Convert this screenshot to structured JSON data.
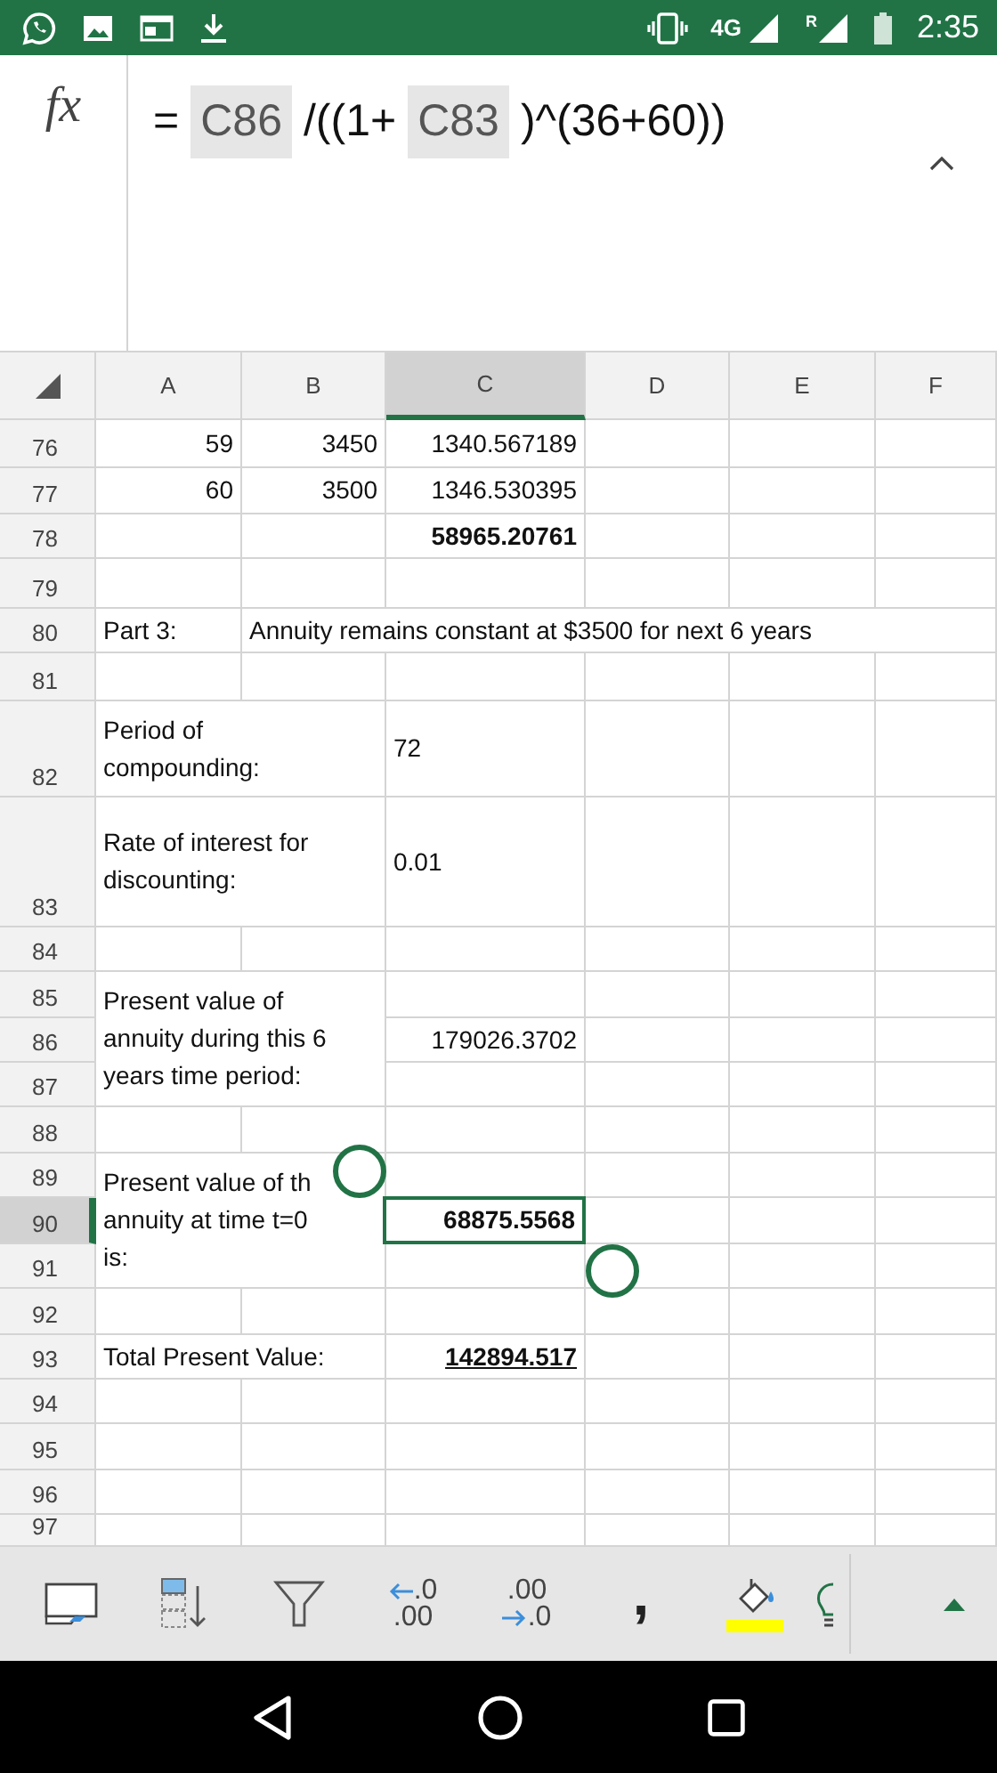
{
  "status_bar": {
    "network": "4G",
    "roaming": "R",
    "time": "2:35"
  },
  "formula_bar": {
    "function_label": "fx",
    "parts": [
      {
        "kind": "operator",
        "text": "="
      },
      {
        "kind": "reference",
        "text": "C86"
      },
      {
        "kind": "operator",
        "text": "/((1+"
      },
      {
        "kind": "reference",
        "text": "C83"
      },
      {
        "kind": "operator",
        "text": ")^(36+60))"
      }
    ]
  },
  "columns": [
    {
      "label": "A",
      "selected": false
    },
    {
      "label": "B",
      "selected": false
    },
    {
      "label": "C",
      "selected": true
    },
    {
      "label": "D",
      "selected": false
    },
    {
      "label": "E",
      "selected": false
    },
    {
      "label": "F",
      "selected": false
    }
  ],
  "rows": [
    {
      "number": "76",
      "selected": false
    },
    {
      "number": "77",
      "selected": false
    },
    {
      "number": "78",
      "selected": false
    },
    {
      "number": "79",
      "selected": false
    },
    {
      "number": "80",
      "selected": false
    },
    {
      "number": "81",
      "selected": false
    },
    {
      "number": "82",
      "selected": false
    },
    {
      "number": "83",
      "selected": false
    },
    {
      "number": "84",
      "selected": false
    },
    {
      "number": "85",
      "selected": false
    },
    {
      "number": "86",
      "selected": false
    },
    {
      "number": "87",
      "selected": false
    },
    {
      "number": "88",
      "selected": false
    },
    {
      "number": "89",
      "selected": false
    },
    {
      "number": "90",
      "selected": true
    },
    {
      "number": "91",
      "selected": false
    },
    {
      "number": "92",
      "selected": false
    },
    {
      "number": "93",
      "selected": false
    },
    {
      "number": "94",
      "selected": false
    },
    {
      "number": "95",
      "selected": false
    },
    {
      "number": "96",
      "selected": false
    },
    {
      "number": "97",
      "selected": false
    }
  ],
  "cells": [
    {
      "text": "59",
      "selected": false
    },
    {
      "text": "3450",
      "selected": false
    },
    {
      "text": "1340.567189",
      "selected": false
    },
    {
      "text": "60",
      "selected": false
    },
    {
      "text": "3500",
      "selected": false
    },
    {
      "text": "1346.530395",
      "selected": false
    },
    {
      "text": "58965.20761",
      "bold": true,
      "selected": false
    },
    {
      "text": "Part 3:",
      "selected": false
    },
    {
      "text": "Annuity remains constant at $3500 for next 6 years",
      "selected": false
    },
    {
      "text": "Period of\ncompounding:",
      "selected": false
    },
    {
      "text": "72",
      "selected": false
    },
    {
      "text": "Rate of interest for\ndiscounting:",
      "selected": false
    },
    {
      "text": "0.01",
      "selected": false
    },
    {
      "text": "Present value of\nannuity during this 6\nyears time period:",
      "selected": false
    },
    {
      "text": "179026.3702",
      "selected": false
    },
    {
      "text": "Present value of th\nannuity at time t=0\nis:",
      "selected": false
    },
    {
      "text": "68875.5568",
      "bold": true,
      "selected": true
    },
    {
      "text": "Total Present Value:",
      "selected": false
    },
    {
      "text": "142894.517",
      "bold": true,
      "underline": true,
      "selected": false
    }
  ],
  "toolbar": [
    {
      "kind": "sheet"
    },
    {
      "kind": "sort"
    },
    {
      "kind": "filter"
    },
    {
      "kind": "decrease_decimal",
      "top": ".0",
      "bottom": ".00"
    },
    {
      "kind": "increase_decimal",
      "top": ".00",
      "bottom": ".0"
    },
    {
      "kind": "comma",
      "glyph": ","
    },
    {
      "kind": "fill",
      "color": "#ffff00"
    },
    {
      "kind": "ideas"
    }
  ]
}
